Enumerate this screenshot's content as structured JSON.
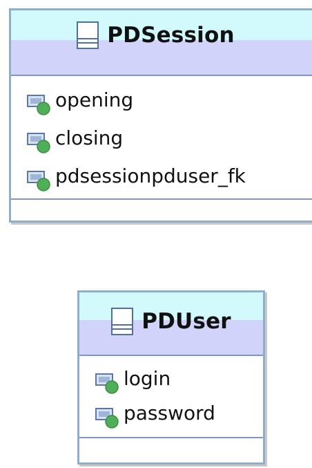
{
  "entities": [
    {
      "name": "PDSession",
      "attributes": [
        "opening",
        "closing",
        "pdsessionpduser_fk"
      ]
    },
    {
      "name": "PDUser",
      "attributes": [
        "login",
        "password"
      ]
    }
  ],
  "colors": {
    "border": "#8eaecb",
    "header_top": "#d2fafd",
    "header_bottom": "#d2d3fa",
    "attr_icon_dot": "#4fae58"
  }
}
